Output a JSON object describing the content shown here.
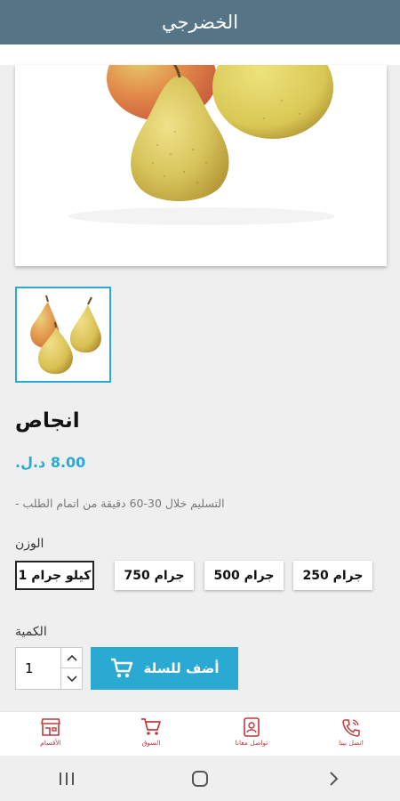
{
  "header": {
    "title": "الخضرجي"
  },
  "product": {
    "name": "انجاص",
    "price": "8.00 د.ل.",
    "delivery_note": "التسليم خلال 30-60 دقيقة من اتمام الطلب -",
    "image": "pears-photo",
    "thumbnail": "pears-thumbnail"
  },
  "weight": {
    "label": "الوزن",
    "options": [
      "كيلو جرام 1",
      "جرام 750",
      "جرام 500",
      "جرام 250"
    ],
    "selected": "كيلو جرام 1"
  },
  "quantity": {
    "label": "الكمية",
    "value": "1"
  },
  "cart_button": {
    "label": "أضف للسلة",
    "icon": "cart-icon"
  },
  "bottom_nav": {
    "items": [
      {
        "label": "الأقسام",
        "icon": "store-icon"
      },
      {
        "label": "السوق",
        "icon": "cart-icon"
      },
      {
        "label": "تواصل معانا",
        "icon": "contact-card-icon"
      },
      {
        "label": "اتصل بينا",
        "icon": "phone-icon"
      }
    ]
  },
  "colors": {
    "header": "#557587",
    "accent": "#2aa9d2",
    "nav_icon": "#c2383b"
  },
  "system_nav": {
    "icons": [
      "recent-apps-icon",
      "home-icon",
      "back-icon"
    ]
  }
}
